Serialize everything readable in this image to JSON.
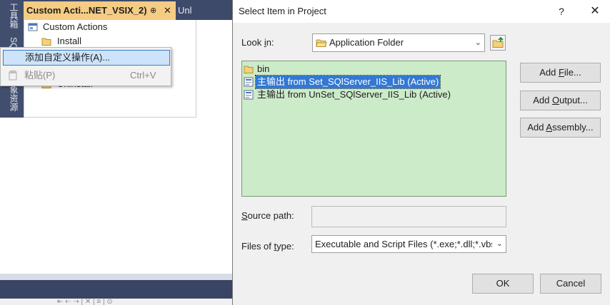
{
  "ide": {
    "side_tabs": [
      "工具箱",
      "SQ",
      "对象资源"
    ],
    "doc_tab_active": "Custom Acti...NET_VSIX_2)",
    "doc_tab_pin": "⊕",
    "doc_tab_close": "✕",
    "doc_tab_2": "Unl",
    "tree": {
      "root": "Custom Actions",
      "install": "Install",
      "uninstall": "Uninstall"
    },
    "context_menu": {
      "item_add_custom_action": "添加自定义操作(A)...",
      "item_paste": "粘贴(P)",
      "item_paste_shortcut": "Ctrl+V"
    },
    "lower_toolbar": "⇤ ⇠ ⇢ | ✕ | ≡ | ⊙"
  },
  "dialog": {
    "title": "Select Item in Project",
    "help": "?",
    "close": "✕",
    "look_in_label_pre": "Look ",
    "look_in_label_ul": "i",
    "look_in_label_post": "n:",
    "look_in_value": "Application Folder",
    "files": [
      {
        "icon": "folder-icon",
        "name": "bin"
      },
      {
        "icon": "project-output-icon",
        "name": "主输出 from Set_SQlServer_IIS_Lib (Active)",
        "selected": true
      },
      {
        "icon": "project-output-icon",
        "name": "主输出 from UnSet_SQlServer_IIS_Lib (Active)"
      }
    ],
    "add_file": {
      "pre": "Add ",
      "ul": "F",
      "post": "ile..."
    },
    "add_output": {
      "pre": "Add ",
      "ul": "O",
      "post": "utput..."
    },
    "add_assembly": {
      "pre": "Add ",
      "ul": "A",
      "post": "ssembly..."
    },
    "source_path_label": {
      "ul": "S",
      "post": "ource path:"
    },
    "source_path_value": "",
    "files_of_type_label": {
      "pre": "Files of ",
      "ul": "t",
      "post": "ype:"
    },
    "files_of_type_value": "Executable and Script Files (*.exe;*.dll;*.vbs;",
    "ok": "OK",
    "cancel": "Cancel"
  }
}
